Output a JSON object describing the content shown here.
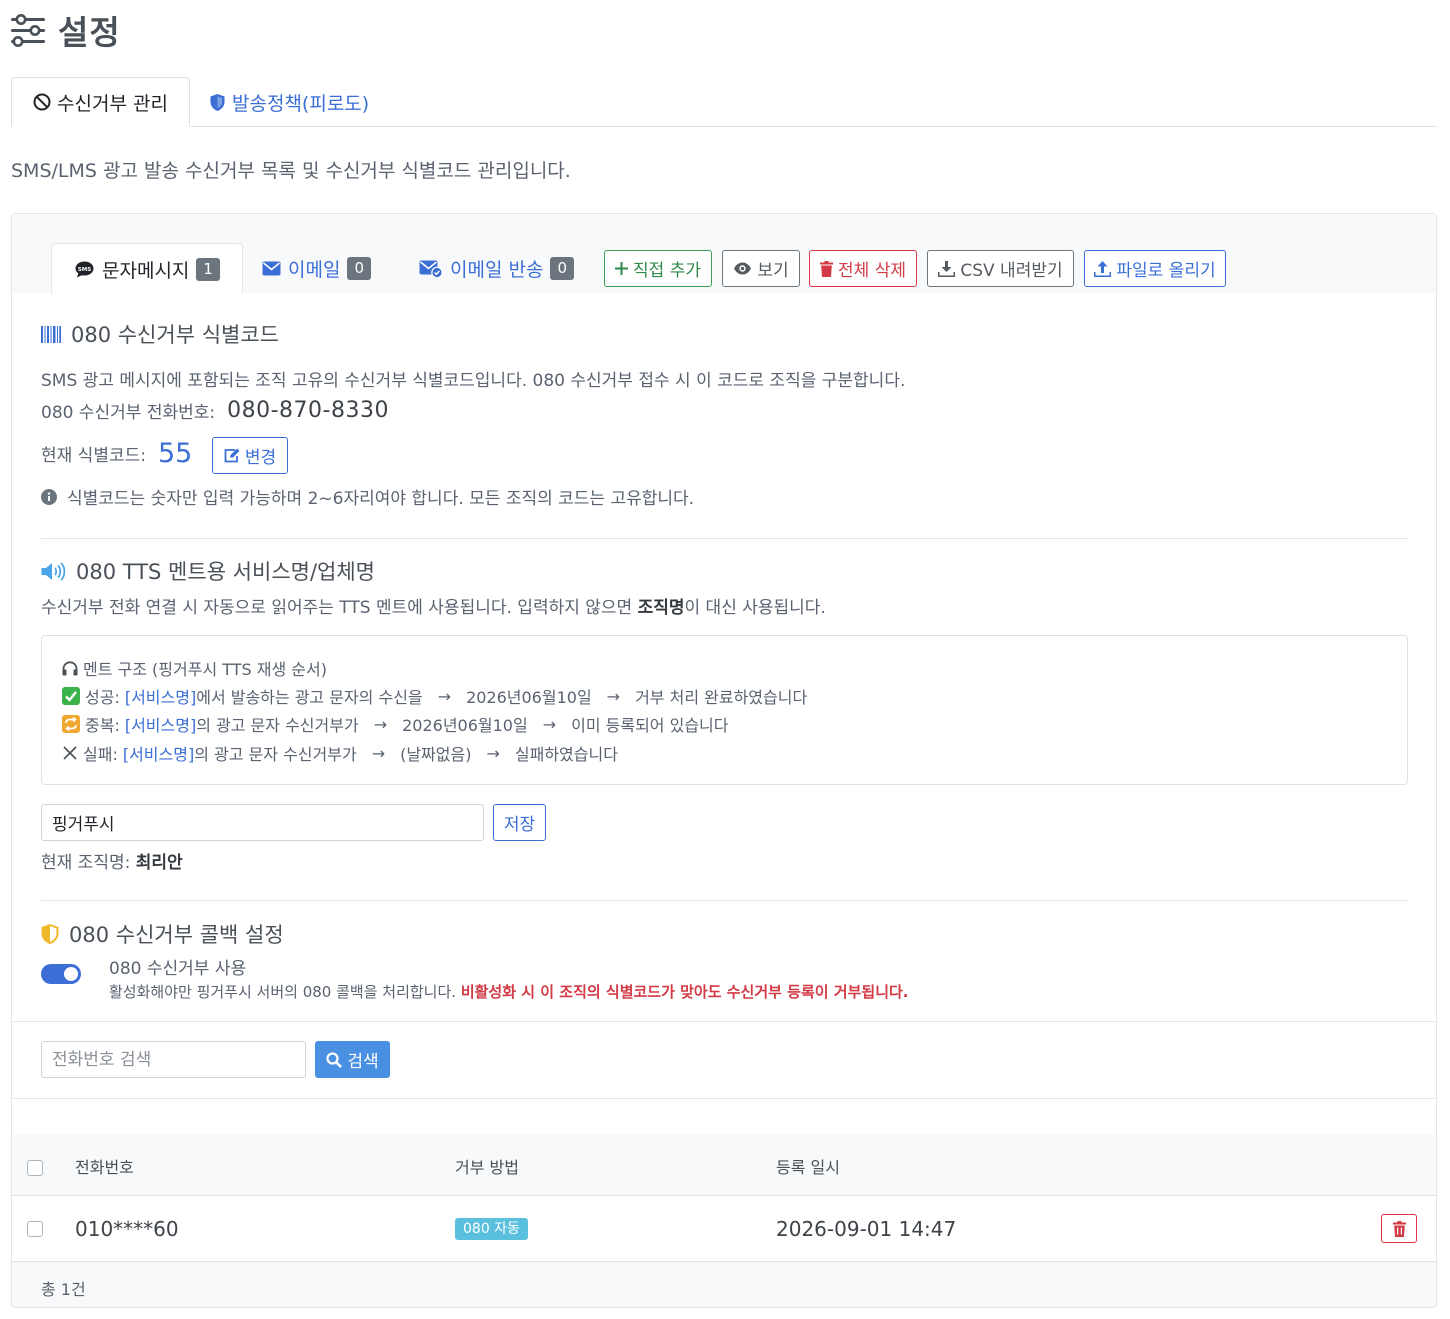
{
  "page": {
    "title": "설정"
  },
  "tabs": [
    {
      "label": "수신거부 관리",
      "active": true
    },
    {
      "label": "발송정책(피로도)",
      "active": false
    }
  ],
  "description": "SMS/LMS 광고 발송 수신거부 목록 및 수신거부 식별코드 관리입니다.",
  "subtabs": [
    {
      "label": "문자메시지",
      "count": "1",
      "active": true
    },
    {
      "label": "이메일",
      "count": "0",
      "active": false
    },
    {
      "label": "이메일 반송",
      "count": "0",
      "active": false
    }
  ],
  "actions": {
    "add": "직접 추가",
    "view": "보기",
    "delete_all": "전체 삭제",
    "csv_download": "CSV 내려받기",
    "upload": "파일로 올리기"
  },
  "code_section": {
    "title": "080 수신거부 식별코드",
    "desc": "SMS 광고 메시지에 포함되는 조직 고유의 수신거부 식별코드입니다. 080 수신거부 접수 시 이 코드로 조직을 구분합니다.",
    "phone_label": "080 수신거부 전화번호:",
    "phone_value": "080-870-8330",
    "code_label": "현재 식별코드:",
    "code_value": "55",
    "change_button": "변경",
    "note": "식별코드는 숫자만 입력 가능하며 2~6자리여야 합니다. 모든 조직의 코드는 고유합니다."
  },
  "tts_section": {
    "title": "080 TTS 멘트용 서비스명/업체명",
    "desc_before": "수신거부 전화 연결 시 자동으로 읽어주는 TTS 멘트에 사용됩니다. 입력하지 않으면 ",
    "desc_bold": "조직명",
    "desc_after": "이 대신 사용됩니다.",
    "ment_title": "멘트 구조 (핑거푸시 TTS 재생 순서)",
    "ment_success": {
      "label": "성공:",
      "service": "[서비스명]",
      "part1": "에서 발송하는 광고 문자의 수신을",
      "date": "2026년06월10일",
      "part2": "거부 처리 완료하였습니다"
    },
    "ment_duplicate": {
      "label": "중복:",
      "service": "[서비스명]",
      "part1": "의 광고 문자 수신거부가",
      "date": "2026년06월10일",
      "part2": "이미 등록되어 있습니다"
    },
    "ment_fail": {
      "label": "실패:",
      "service": "[서비스명]",
      "part1": "의 광고 문자 수신거부가",
      "date": "(날짜없음)",
      "part2": "실패하였습니다"
    },
    "arrow": "→",
    "input_value": "핑거푸시",
    "save_button": "저장",
    "current_label": "현재 조직명:",
    "current_value": "최리안"
  },
  "callback_section": {
    "title": "080 수신거부 콜백 설정",
    "toggle_label": "080 수신거부 사용",
    "toggle_on": true,
    "desc": "활성화해야만 핑거푸시 서버의 080 콜백을 처리합니다. ",
    "desc_warning": "비활성화 시 이 조직의 식별코드가 맞아도 수신거부 등록이 거부됩니다."
  },
  "search": {
    "placeholder": "전화번호 검색",
    "button": "검색"
  },
  "table": {
    "columns": [
      "전화번호",
      "거부 방법",
      "등록 일시"
    ],
    "rows": [
      {
        "phone": "010****60",
        "method": "080 자동",
        "date": "2026-09-01 14:47"
      }
    ]
  },
  "footer": {
    "total": "총 1건"
  },
  "colors": {
    "primary": "#3b6fd6",
    "danger": "#dc3545",
    "success": "#3c9b57",
    "secondary": "#6c757d",
    "info": "#5bc0de"
  }
}
